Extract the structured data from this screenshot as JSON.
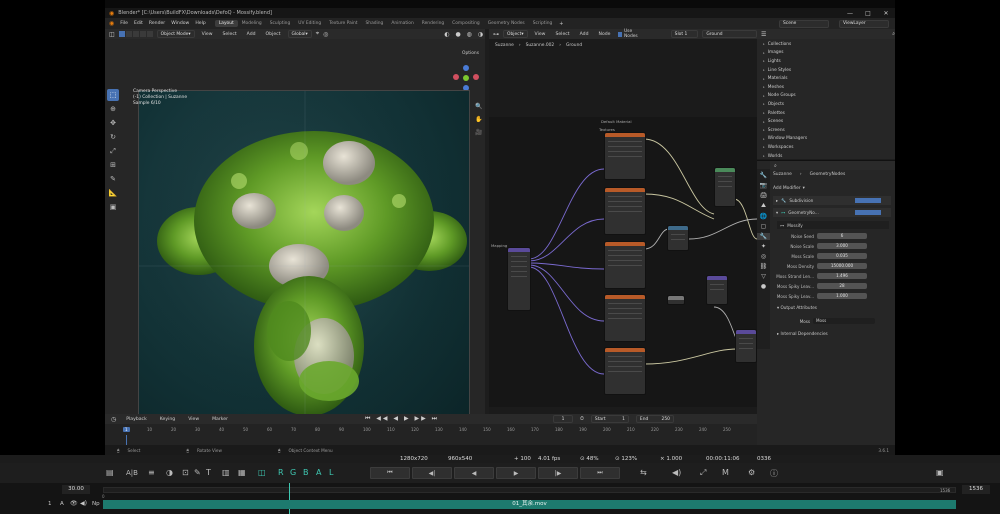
{
  "window": {
    "title": "Blender* [C:\\Users\\BuildFX\\Downloads\\DefoQ - Mossify.blend]",
    "minimize": "—",
    "maximize": "□",
    "close": "✕"
  },
  "menubar": {
    "items": [
      "File",
      "Edit",
      "Render",
      "Window",
      "Help"
    ],
    "workspaces": [
      "Layout",
      "Modeling",
      "Sculpting",
      "UV Editing",
      "Texture Paint",
      "Shading",
      "Animation",
      "Rendering",
      "Compositing",
      "Geometry Nodes",
      "Scripting"
    ],
    "active_workspace": "Layout",
    "scene": "Scene",
    "view_layer": "ViewLayer"
  },
  "viewport": {
    "mode": "Object Mode",
    "menus": [
      "View",
      "Select",
      "Add",
      "Object"
    ],
    "orientation": "Global",
    "options": "Options",
    "camera_label": "Camera Perspective",
    "collection_label": "(-1) Collection | Suzanne",
    "sample_label": "Sample 6/10"
  },
  "node_editor": {
    "editor_type": "Object",
    "menus": [
      "View",
      "Select",
      "Add",
      "Node"
    ],
    "use_nodes": "Use Nodes",
    "slot": "Slot 1",
    "material": "Ground",
    "breadcrumb_object": "Suzanne",
    "breadcrumb_mesh": "Suzanne.002",
    "breadcrumb_material": "Ground",
    "frame_label": "Default Material",
    "mapping_label": "Mapping",
    "textures_label": "Textures"
  },
  "outliner": {
    "items": [
      "Collections",
      "Images",
      "Lights",
      "Line Styles",
      "Materials",
      "Meshes",
      "Node Groups",
      "Objects",
      "Palettes",
      "Scenes",
      "Screens",
      "Window Managers",
      "Workspaces",
      "Worlds"
    ]
  },
  "properties": {
    "object": "Suzanne",
    "modifier_group": "GeometryNodes",
    "add_modifier": "Add Modifier",
    "modifiers": [
      "Subdivision",
      "GeometryNo..."
    ],
    "node_group": "Mossify",
    "fields": [
      {
        "label": "Noise Seed",
        "value": "6"
      },
      {
        "label": "Noise Scale",
        "value": "3.000"
      },
      {
        "label": "Moss Scale",
        "value": "0.035"
      },
      {
        "label": "Moss Density",
        "value": "15000.000"
      },
      {
        "label": "Moss Strand Len...",
        "value": "1.496"
      },
      {
        "label": "Moss Spiky Leav...",
        "value": "28"
      },
      {
        "label": "Moss Spiky Leav...",
        "value": "1.000"
      }
    ],
    "output_attributes": "Output Attributes",
    "moss_label": "Moss",
    "moss_value": "Moss",
    "internal_dependencies": "Internal Dependencies"
  },
  "timeline": {
    "menus": [
      "Playback",
      "Keying",
      "View",
      "Marker"
    ],
    "current_frame": "1",
    "start_label": "Start",
    "start": "1",
    "end_label": "End",
    "end": "250",
    "ruler": [
      "1",
      "10",
      "20",
      "30",
      "40",
      "50",
      "60",
      "70",
      "80",
      "90",
      "100",
      "110",
      "120",
      "130",
      "140",
      "150",
      "160",
      "170",
      "180",
      "190",
      "200",
      "210",
      "220",
      "230",
      "240",
      "250"
    ]
  },
  "statusbar": {
    "select": "Select",
    "rotate": "Rotate View",
    "context": "Object Context Menu",
    "version": "3.6.1"
  },
  "player": {
    "resolution": "1280x720",
    "scaled": "960x540",
    "speed": "100",
    "fps": "4.01 fps",
    "zoom": "48%",
    "zoom2": "123%",
    "rate": "1.000",
    "timecode": "00:00:11:06",
    "frame": "0336",
    "letters_ab": "A|B",
    "channels": [
      "R",
      "G",
      "B",
      "A",
      "L"
    ],
    "m_label": "M",
    "framerate": "30.00",
    "total": "1536",
    "marker_left": "0",
    "marker_right": "1536",
    "track_index": "1",
    "track_a": "A",
    "track_np": "Np",
    "clip": "01_其余.mov"
  },
  "colors": {
    "accent": "#4772b3",
    "moss": "#6fae2c",
    "teal": "#3fc8b2",
    "node_orange": "#b85a28",
    "node_purple": "#5a4a9a"
  }
}
